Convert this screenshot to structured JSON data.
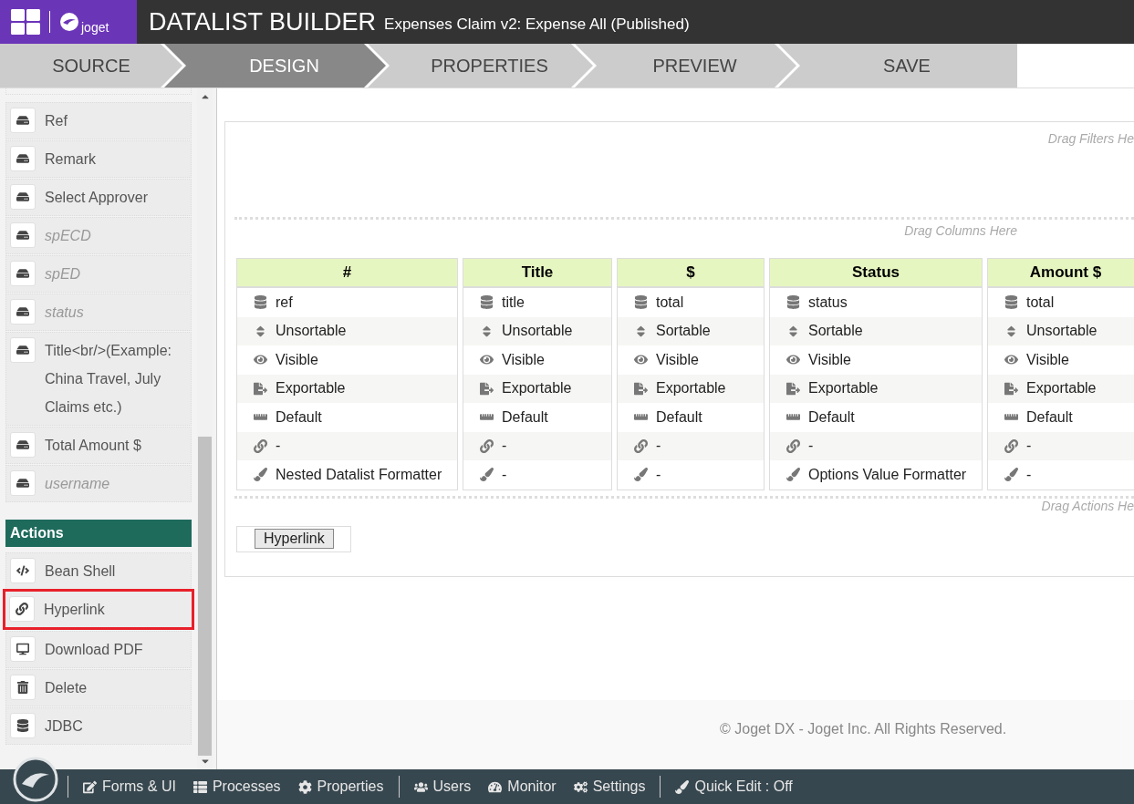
{
  "header": {
    "app_name": "joget",
    "title": "DATALIST BUILDER",
    "subtitle": "Expenses Claim v2: Expense All (Published)"
  },
  "steps": [
    {
      "label": "SOURCE",
      "selected": false
    },
    {
      "label": "DESIGN",
      "selected": true
    },
    {
      "label": "PROPERTIES",
      "selected": false
    },
    {
      "label": "PREVIEW",
      "selected": false
    },
    {
      "label": "SAVE",
      "selected": false
    }
  ],
  "sidebar": {
    "fields": [
      {
        "label": "Ref",
        "muted": false
      },
      {
        "label": "Remark",
        "muted": false
      },
      {
        "label": "Select Approver",
        "muted": false
      },
      {
        "label": "spECD",
        "muted": true
      },
      {
        "label": "spED",
        "muted": true
      },
      {
        "label": "status",
        "muted": true
      },
      {
        "label": "Title<br/>(Example: China Travel, July Claims etc.)",
        "muted": false
      },
      {
        "label": "Total Amount $",
        "muted": false
      },
      {
        "label": "username",
        "muted": true
      }
    ],
    "actions_title": "Actions",
    "actions": [
      {
        "label": "Bean Shell",
        "kind": "code",
        "highlighted": false
      },
      {
        "label": "Hyperlink",
        "kind": "link",
        "highlighted": true
      },
      {
        "label": "Download PDF",
        "kind": "pdf",
        "highlighted": false
      },
      {
        "label": "Delete",
        "kind": "delete",
        "highlighted": false
      },
      {
        "label": "JDBC",
        "kind": "database",
        "highlighted": false
      }
    ]
  },
  "canvas": {
    "filters_hint": "Drag Filters He",
    "columns_hint": "Drag Columns Here",
    "actions_hint": "Drag Actions He",
    "columns": [
      {
        "header": "#",
        "properties": [
          {
            "kind": "source",
            "text": "ref"
          },
          {
            "kind": "sort",
            "text": "Unsortable"
          },
          {
            "kind": "visibility",
            "text": "Visible"
          },
          {
            "kind": "export",
            "text": "Exportable"
          },
          {
            "kind": "width",
            "text": "Default"
          },
          {
            "kind": "link",
            "text": "-"
          },
          {
            "kind": "formatter",
            "text": "Nested Datalist Formatter"
          }
        ]
      },
      {
        "header": "Title",
        "properties": [
          {
            "kind": "source",
            "text": "title"
          },
          {
            "kind": "sort",
            "text": "Unsortable"
          },
          {
            "kind": "visibility",
            "text": "Visible"
          },
          {
            "kind": "export",
            "text": "Exportable"
          },
          {
            "kind": "width",
            "text": "Default"
          },
          {
            "kind": "link",
            "text": "-"
          },
          {
            "kind": "formatter",
            "text": "-"
          }
        ]
      },
      {
        "header": "$",
        "properties": [
          {
            "kind": "source",
            "text": "total"
          },
          {
            "kind": "sort",
            "text": "Sortable"
          },
          {
            "kind": "visibility",
            "text": "Visible"
          },
          {
            "kind": "export",
            "text": "Exportable"
          },
          {
            "kind": "width",
            "text": "Default"
          },
          {
            "kind": "link",
            "text": "-"
          },
          {
            "kind": "formatter",
            "text": "-"
          }
        ]
      },
      {
        "header": "Status",
        "properties": [
          {
            "kind": "source",
            "text": "status"
          },
          {
            "kind": "sort",
            "text": "Sortable"
          },
          {
            "kind": "visibility",
            "text": "Visible"
          },
          {
            "kind": "export",
            "text": "Exportable"
          },
          {
            "kind": "width",
            "text": "Default"
          },
          {
            "kind": "link",
            "text": "-"
          },
          {
            "kind": "formatter",
            "text": "Options Value Formatter"
          }
        ]
      },
      {
        "header": "Amount $",
        "properties": [
          {
            "kind": "source",
            "text": "total"
          },
          {
            "kind": "sort",
            "text": "Unsortable"
          },
          {
            "kind": "visibility",
            "text": "Visible"
          },
          {
            "kind": "export",
            "text": "Exportable"
          },
          {
            "kind": "width",
            "text": "Default"
          },
          {
            "kind": "link",
            "text": "-"
          },
          {
            "kind": "formatter",
            "text": "-"
          }
        ]
      }
    ],
    "action_buttons": [
      "Hyperlink"
    ]
  },
  "footer": "© Joget DX - Joget Inc. All Rights Reserved.",
  "bottom_bar": {
    "groups": [
      [
        {
          "kind": "forms",
          "label": "Forms & UI"
        },
        {
          "kind": "processes",
          "label": "Processes"
        },
        {
          "kind": "properties",
          "label": "Properties"
        }
      ],
      [
        {
          "kind": "users",
          "label": "Users"
        },
        {
          "kind": "monitor",
          "label": "Monitor"
        },
        {
          "kind": "settings",
          "label": "Settings"
        }
      ],
      [
        {
          "kind": "quickedit",
          "label": "Quick Edit : Off"
        }
      ]
    ]
  }
}
